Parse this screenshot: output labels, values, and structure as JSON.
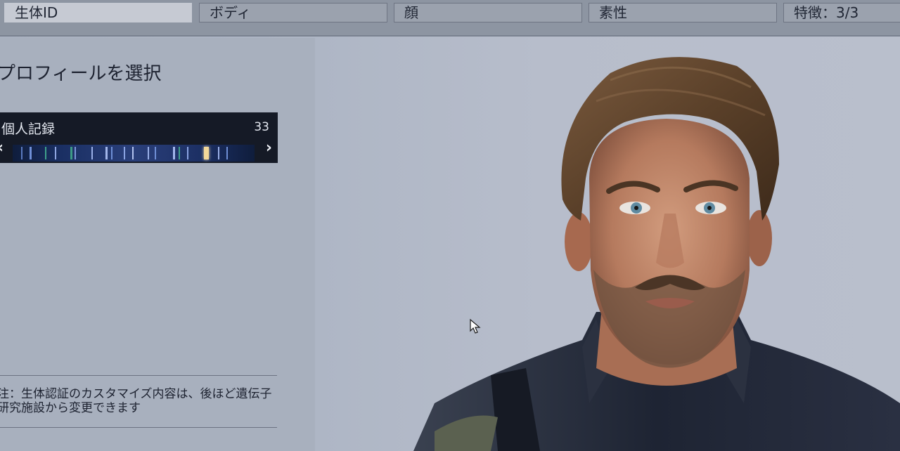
{
  "tabs": [
    {
      "label": "生体ID",
      "active": true
    },
    {
      "label": "ボディ",
      "active": false
    },
    {
      "label": "顔",
      "active": false
    },
    {
      "label": "素性",
      "active": false
    },
    {
      "label": "特徴：3/3",
      "active": false
    }
  ],
  "panel": {
    "title": "プロフィールを選択",
    "selector": {
      "label": "個人記録",
      "count": "33",
      "prev_icon": "‹",
      "next_icon": "›"
    },
    "note": "注：生体認証のカスタマイズ内容は、後ほど遺伝子研究施設から変更できます"
  },
  "colors": {
    "tab_active": "#c6cad3",
    "selector_bg": "#151a26",
    "dna_highlight": "#f3d89a"
  }
}
